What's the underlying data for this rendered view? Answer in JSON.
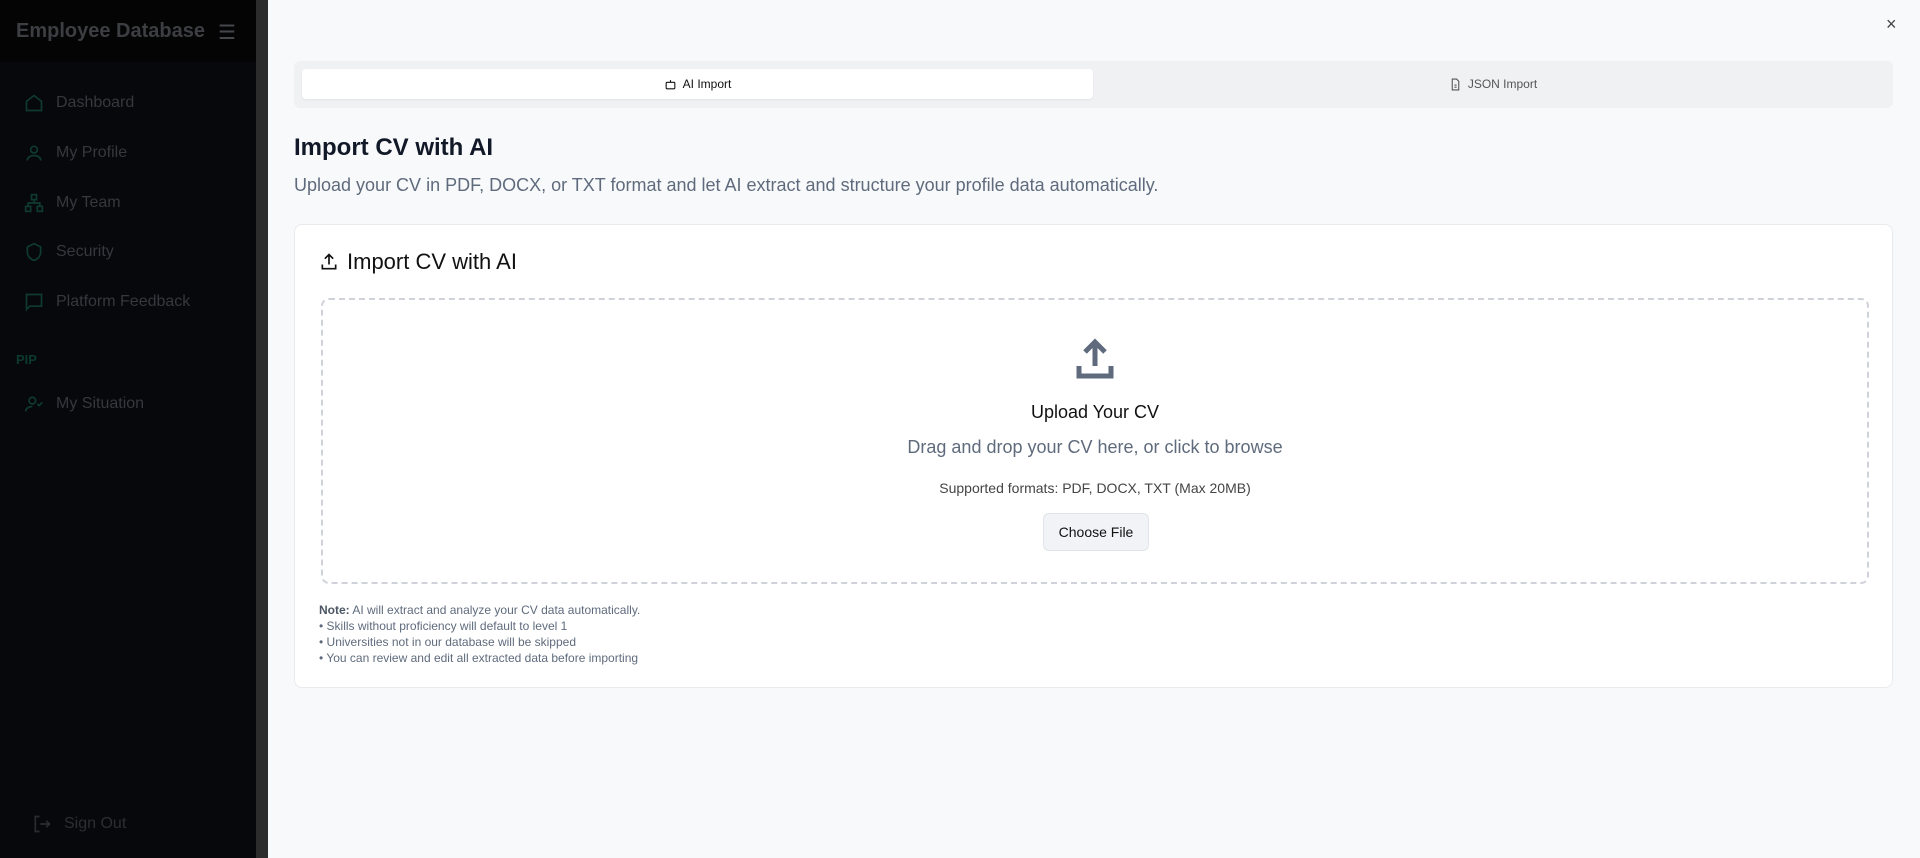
{
  "sidebar": {
    "title": "Employee Database",
    "items": [
      {
        "label": "Dashboard",
        "icon": "home-icon"
      },
      {
        "label": "My Profile",
        "icon": "user-icon"
      },
      {
        "label": "My Team",
        "icon": "network-icon"
      },
      {
        "label": "Security",
        "icon": "shield-icon"
      },
      {
        "label": "Platform Feedback",
        "icon": "message-icon"
      }
    ],
    "section": "PIP",
    "section_items": [
      {
        "label": "My Situation",
        "icon": "user-check-icon"
      }
    ],
    "sign_out": "Sign Out"
  },
  "tabs": [
    {
      "label": "AI Import",
      "active": true
    },
    {
      "label": "JSON Import",
      "active": false
    }
  ],
  "header": {
    "title": "Import CV with AI",
    "subtitle": "Upload your CV in PDF, DOCX, or TXT format and let AI extract and structure your profile data automatically."
  },
  "card": {
    "title": "Import CV with AI",
    "drop_title": "Upload Your CV",
    "drop_text": "Drag and drop your CV here, or click to browse",
    "formats": "Supported formats: PDF, DOCX, TXT (Max 20MB)",
    "button": "Choose File",
    "note_label": "Note:",
    "note_text": " AI will extract and analyze your CV data automatically.",
    "bullets": [
      "• Skills without proficiency will default to level 1",
      "• Universities not in our database will be skipped",
      "• You can review and edit all extracted data before importing"
    ]
  },
  "close": "×"
}
